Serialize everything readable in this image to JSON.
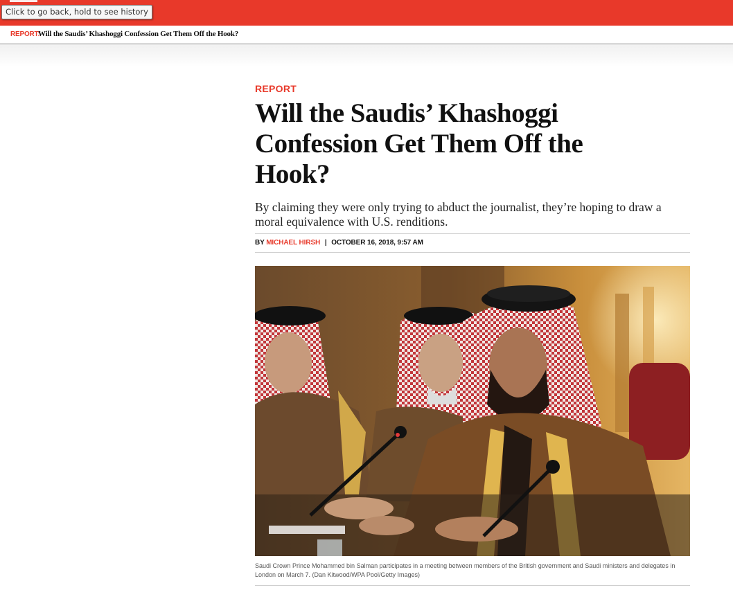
{
  "browser": {
    "tooltip": "Click to go back, hold to see history"
  },
  "subbar": {
    "kicker": "REPORT:",
    "title": "Will the Saudis’ Khashoggi Confession Get Them Off the Hook?"
  },
  "article": {
    "section": "REPORT",
    "headline": "Will the Saudis’ Khashoggi Confession Get Them Off the Hook?",
    "dek": "By claiming they were only trying to abduct the journalist, they’re hoping to draw a moral equivalence with U.S. renditions.",
    "byline_prefix": "BY",
    "author": "MICHAEL HIRSH",
    "byline_sep": "|",
    "date": "OCTOBER 16, 2018, 9:57 AM",
    "caption": "Saudi Crown Prince Mohammed bin Salman participates in a meeting between members of the British government and Saudi ministers and delegates in London on March 7. (Dan Kitwood/WPA Pool/Getty Images)"
  },
  "colors": {
    "brand_red": "#e8392a",
    "text": "#111111"
  }
}
